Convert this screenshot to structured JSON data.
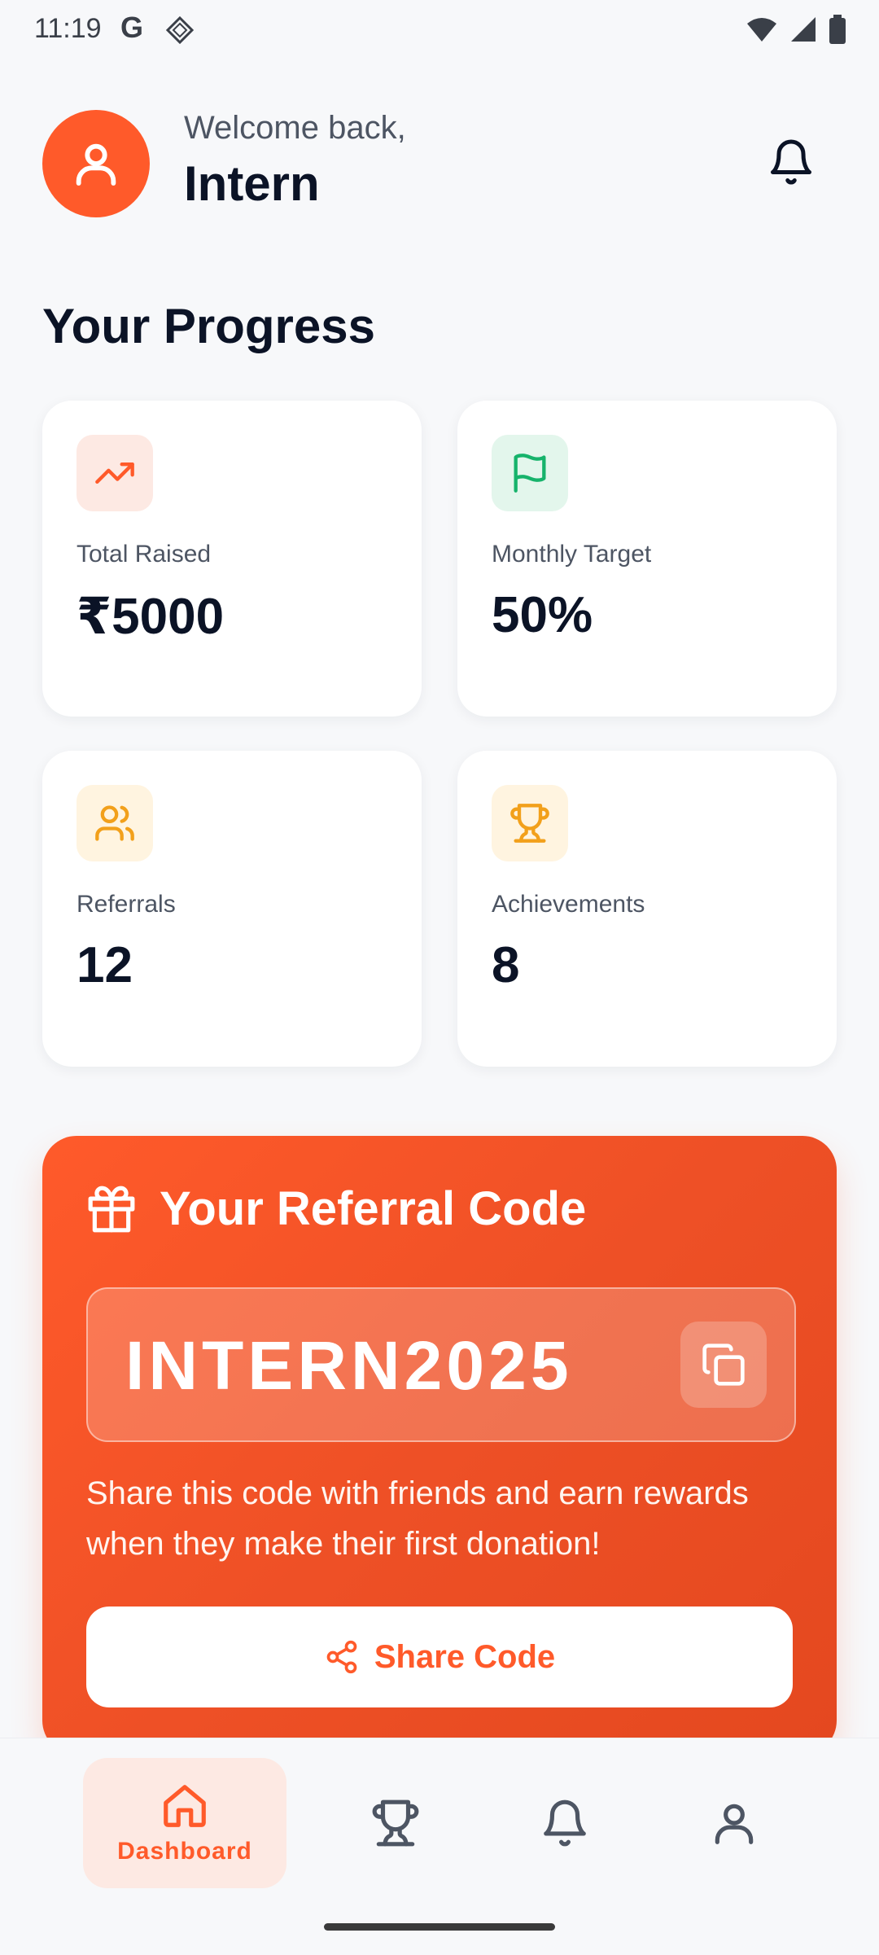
{
  "status_bar": {
    "time": "11:19",
    "g_label": "G"
  },
  "header": {
    "welcome": "Welcome back,",
    "username": "Intern"
  },
  "progress": {
    "title": "Your Progress",
    "cards": [
      {
        "label": "Total Raised",
        "value": "₹5000",
        "icon": "trending-up-icon",
        "accent": "#ff5a2a",
        "bg": "#fde9e3"
      },
      {
        "label": "Monthly Target",
        "value": "50%",
        "icon": "flag-icon",
        "accent": "#16b36b",
        "bg": "#e3f6ec"
      },
      {
        "label": "Referrals",
        "value": "12",
        "icon": "users-icon",
        "accent": "#f2a01b",
        "bg": "#fff4e0"
      },
      {
        "label": "Achievements",
        "value": "8",
        "icon": "trophy-icon",
        "accent": "#f2a01b",
        "bg": "#fff4e0"
      }
    ]
  },
  "referral": {
    "title": "Your Referral Code",
    "code": "INTERN2025",
    "description": "Share this code with friends and earn rewards when they make their first donation!",
    "share_label": "Share Code",
    "accent": "#ff5a2a"
  },
  "bottom_nav": {
    "items": [
      {
        "label": "Dashboard",
        "icon": "home-icon",
        "active": true
      },
      {
        "label": "",
        "icon": "trophy-icon",
        "active": false
      },
      {
        "label": "",
        "icon": "bell-icon",
        "active": false
      },
      {
        "label": "",
        "icon": "user-icon",
        "active": false
      }
    ]
  }
}
